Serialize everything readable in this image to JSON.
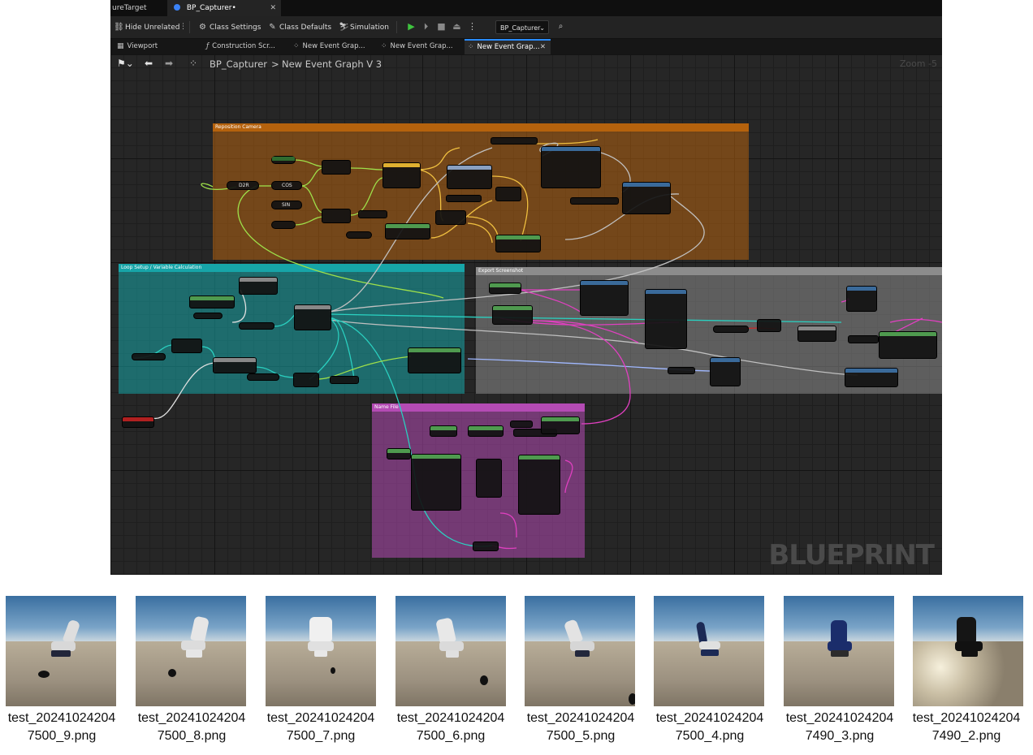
{
  "doc_tabs": [
    {
      "label": "ureTarget",
      "active": false
    },
    {
      "label": "BP_Capturer•",
      "active": true
    }
  ],
  "toolbar": {
    "hide_unrelated": "Hide Unrelated",
    "class_settings": "Class Settings",
    "class_defaults": "Class Defaults",
    "simulation": "Simulation",
    "debug_object": "BP_Capturer"
  },
  "sub_tabs": [
    {
      "label": "Viewport",
      "icon": "viewport-icon"
    },
    {
      "label": "Construction Scr...",
      "icon": "function-icon"
    },
    {
      "label": "New Event Grap...",
      "icon": "event-graph-icon"
    },
    {
      "label": "New Event Grap...",
      "icon": "event-graph-icon"
    },
    {
      "label": "New Event Grap...",
      "icon": "event-graph-icon",
      "active": true
    }
  ],
  "breadcrumb": {
    "root": "BP_Capturer",
    "separator": ">",
    "current": "New Event Graph V 3"
  },
  "zoom_label": "Zoom -5",
  "watermark": "BLUEPRINT",
  "comments": [
    {
      "title": "Reposition Camera",
      "color": "#b5620d"
    },
    {
      "title": "Loop Setup / Variable Calculation",
      "color": "#17a5a8"
    },
    {
      "title": "Export Screenshot",
      "color": "#8c8c8c"
    },
    {
      "title": "Name File",
      "color": "#b44bb4"
    }
  ],
  "node_labels": {
    "d2r": "D2R",
    "cos": "COS",
    "sin": "SIN"
  },
  "thumbnails": [
    {
      "line1": "test_20241024204",
      "line2": "7500_9.png",
      "chair": "#dedede"
    },
    {
      "line1": "test_20241024204",
      "line2": "7500_8.png",
      "chair": "#e6e6e6"
    },
    {
      "line1": "test_20241024204",
      "line2": "7500_7.png",
      "chair": "#f0f0f0"
    },
    {
      "line1": "test_20241024204",
      "line2": "7500_6.png",
      "chair": "#e8e8e8"
    },
    {
      "line1": "test_20241024204",
      "line2": "7500_5.png",
      "chair": "#e3e3e3"
    },
    {
      "line1": "test_20241024204",
      "line2": "7500_4.png",
      "chair": "#1c2a55"
    },
    {
      "line1": "test_20241024204",
      "line2": "7490_3.png",
      "chair": "#1b2d6b"
    },
    {
      "line1": "test_20241024204",
      "line2": "7490_2.png",
      "chair": "#151515"
    }
  ]
}
